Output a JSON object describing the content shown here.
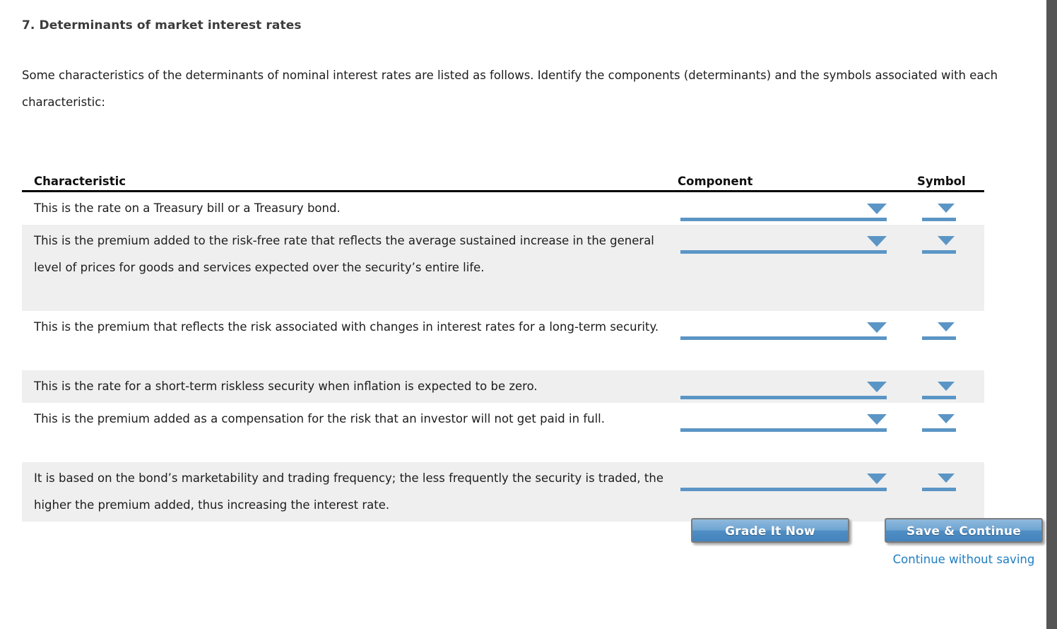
{
  "question": {
    "title": "7. Determinants of market interest rates",
    "intro": "Some characteristics of the determinants of nominal interest rates are listed as follows. Identify the components (determinants) and the symbols associated with each characteristic:"
  },
  "table": {
    "headers": {
      "characteristic": "Characteristic",
      "component": "Component",
      "symbol": "Symbol"
    },
    "rows": [
      {
        "characteristic": "This is the rate on a Treasury bill or a Treasury bond.",
        "component_value": "",
        "symbol_value": "",
        "shaded": false,
        "lines": 1
      },
      {
        "characteristic": "This is the premium added to the risk-free rate that reflects the average sustained increase in the general level of prices for goods and services expected over the security’s entire life.",
        "component_value": "",
        "symbol_value": "",
        "shaded": true,
        "lines": 3
      },
      {
        "characteristic": "This is the premium that reflects the risk associated with changes in interest rates for a long-term security.",
        "component_value": "",
        "symbol_value": "",
        "shaded": false,
        "lines": 2
      },
      {
        "characteristic": "This is the rate for a short-term riskless security when inflation is expected to be zero.",
        "component_value": "",
        "symbol_value": "",
        "shaded": true,
        "lines": 1
      },
      {
        "characteristic": "This is the premium added as a compensation for the risk that an investor will not get paid in full.",
        "component_value": "",
        "symbol_value": "",
        "shaded": false,
        "lines": 2
      },
      {
        "characteristic": "It is based on the bond’s marketability and trading frequency; the less frequently the security is traded, the higher the premium added, thus increasing the interest rate.",
        "component_value": "",
        "symbol_value": "",
        "shaded": true,
        "lines": 2
      }
    ]
  },
  "actions": {
    "grade_label": "Grade It Now",
    "save_label": "Save & Continue",
    "continue_without_saving_label": "Continue without saving"
  },
  "colors": {
    "accent_blue": "#5b95c5",
    "link_blue": "#1f7ec4",
    "row_shade": "#efefef",
    "gutter": "#555555",
    "button_border": "#7c7c7c"
  },
  "icons": {
    "dropdown_component": "chevron-down-icon",
    "dropdown_symbol": "chevron-down-icon"
  }
}
